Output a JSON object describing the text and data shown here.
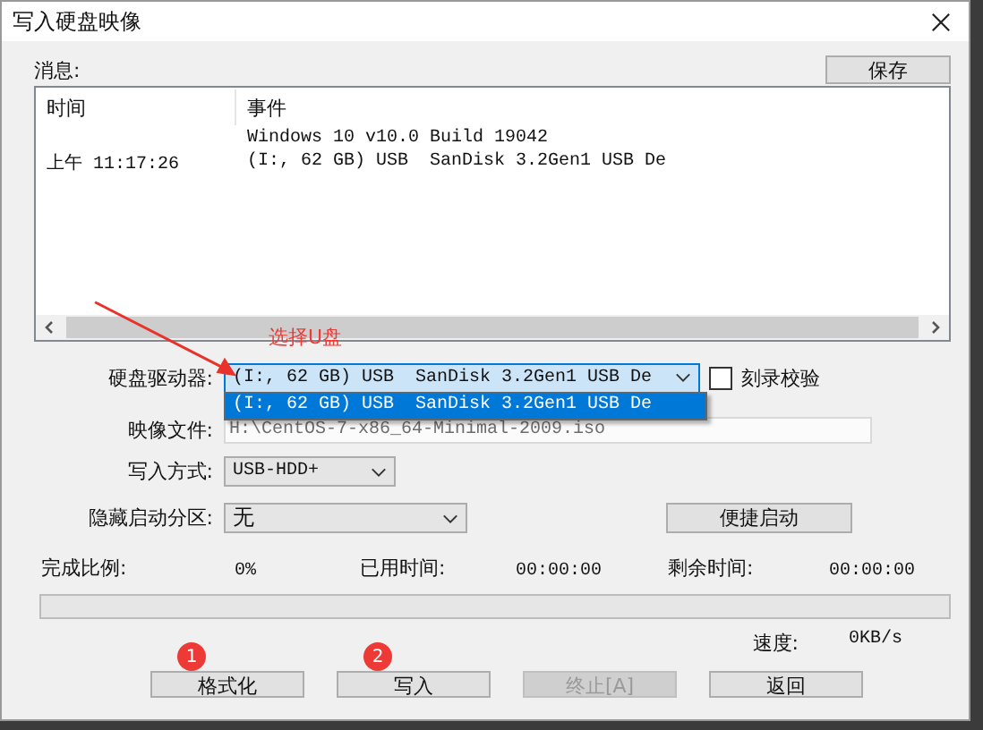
{
  "window": {
    "title": "写入硬盘映像"
  },
  "messages": {
    "label": "消息:",
    "save_button": "保存",
    "columns": [
      "时间",
      "事件"
    ],
    "rows": [
      {
        "event": "Windows 10 v10.0 Build 19042"
      },
      {
        "time": "上午 11:17:26",
        "event": "(I:, 62 GB) USB  SanDisk 3.2Gen1 USB De"
      }
    ]
  },
  "annotation": {
    "text": "选择U盘"
  },
  "drive": {
    "label": "硬盘驱动器:",
    "value": "(I:, 62 GB) USB  SanDisk 3.2Gen1 USB De",
    "expanded": true,
    "options": [
      {
        "label": "(I:, 62 GB) USB  SanDisk 3.2Gen1 USB De",
        "selected": true
      }
    ]
  },
  "verify": {
    "label": "刻录校验",
    "checked": false
  },
  "image_file": {
    "label": "映像文件:",
    "value": "H:\\CentOS-7-x86_64-Minimal-2009.iso",
    "disabled": true
  },
  "write_mode": {
    "label": "写入方式:",
    "value": "USB-HDD+"
  },
  "hidden_partition": {
    "label": "隐藏启动分区:",
    "value": "无"
  },
  "quick_boot_button": "便捷启动",
  "progress": {
    "stats": [
      {
        "label": "完成比例:",
        "value": "0%"
      },
      {
        "label": "已用时间:",
        "value": "00:00:00"
      },
      {
        "label": "剩余时间:",
        "value": "00:00:00"
      }
    ],
    "level": 0,
    "speed_label": "速度:",
    "speed": "0KB/s"
  },
  "buttons": [
    {
      "label": "格式化",
      "disabled": false,
      "badge": "1"
    },
    {
      "label": "写入",
      "disabled": false,
      "badge": "2"
    },
    {
      "label": "终止[A]",
      "disabled": true
    },
    {
      "label": "返回",
      "disabled": false
    }
  ]
}
